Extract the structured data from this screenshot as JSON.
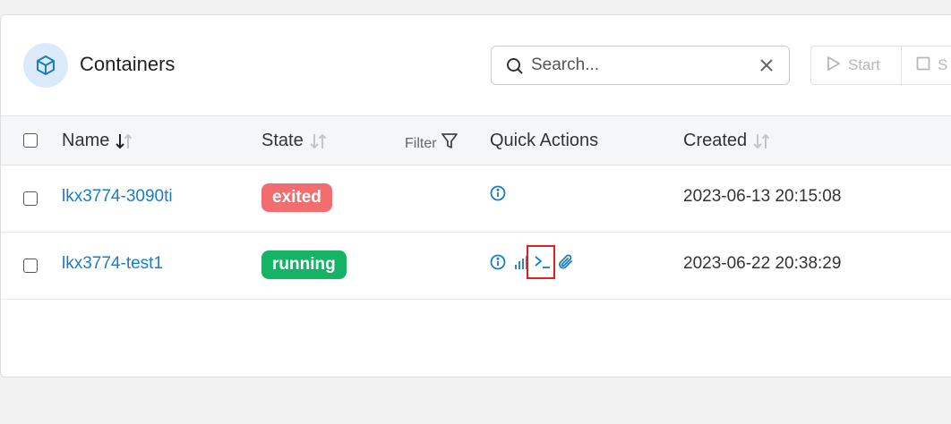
{
  "header": {
    "title": "Containers",
    "title_icon": "cube-icon",
    "search_placeholder": "Search...",
    "start_label": "Start",
    "stop_label": "S"
  },
  "table": {
    "columns": {
      "name": "Name",
      "state": "State",
      "filter": "Filter",
      "quick_actions": "Quick Actions",
      "created": "Created"
    },
    "rows": [
      {
        "name": "lkx3774-3090ti",
        "state": "exited",
        "state_color": "#f26d6d",
        "quick_actions": [
          "info-icon"
        ],
        "created": "2023-06-13 20:15:08"
      },
      {
        "name": "lkx3774-test1",
        "state": "running",
        "state_color": "#16b364",
        "quick_actions": [
          "info-icon",
          "stats-icon",
          "console-icon",
          "attach-icon"
        ],
        "created": "2023-06-22 20:38:29"
      }
    ]
  },
  "colors": {
    "accent": "#1a7dc4",
    "highlight": "#e02020"
  }
}
